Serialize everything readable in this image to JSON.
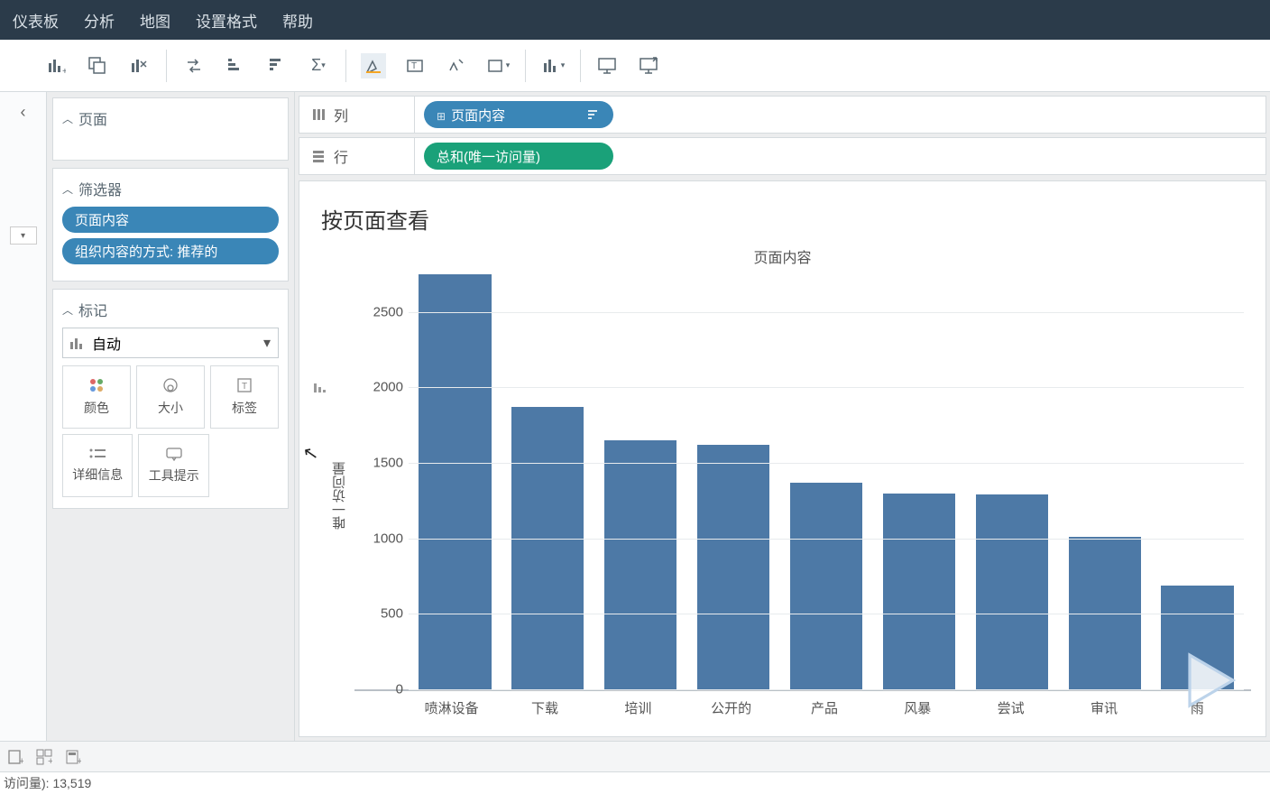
{
  "menu": {
    "items": [
      "仪表板",
      "分析",
      "地图",
      "设置格式",
      "帮助"
    ]
  },
  "shelves": {
    "columns": {
      "label": "列",
      "pill": "页面内容"
    },
    "rows": {
      "label": "行",
      "pill": "总和(唯一访问量)"
    }
  },
  "panels": {
    "pages": {
      "title": "页面"
    },
    "filters": {
      "title": "筛选器",
      "pills": [
        "页面内容",
        "组织内容的方式: 推荐的"
      ]
    },
    "marks": {
      "title": "标记",
      "type_label": "自动",
      "cells": [
        "颜色",
        "大小",
        "标签",
        "详细信息",
        "工具提示"
      ]
    }
  },
  "chart_data": {
    "type": "bar",
    "title": "按页面查看",
    "axis_header": "页面内容",
    "ylabel": "唯一访问量",
    "ylim": [
      0,
      2750
    ],
    "yticks": [
      0,
      500,
      1000,
      1500,
      2000,
      2500
    ],
    "categories": [
      "喷淋设备",
      "下载",
      "培训",
      "公开的",
      "产品",
      "风暴",
      "尝试",
      "审讯",
      "雨"
    ],
    "values": [
      2750,
      1870,
      1650,
      1620,
      1370,
      1300,
      1290,
      1010,
      690
    ]
  },
  "status": {
    "text": "访问量): 13,519"
  }
}
